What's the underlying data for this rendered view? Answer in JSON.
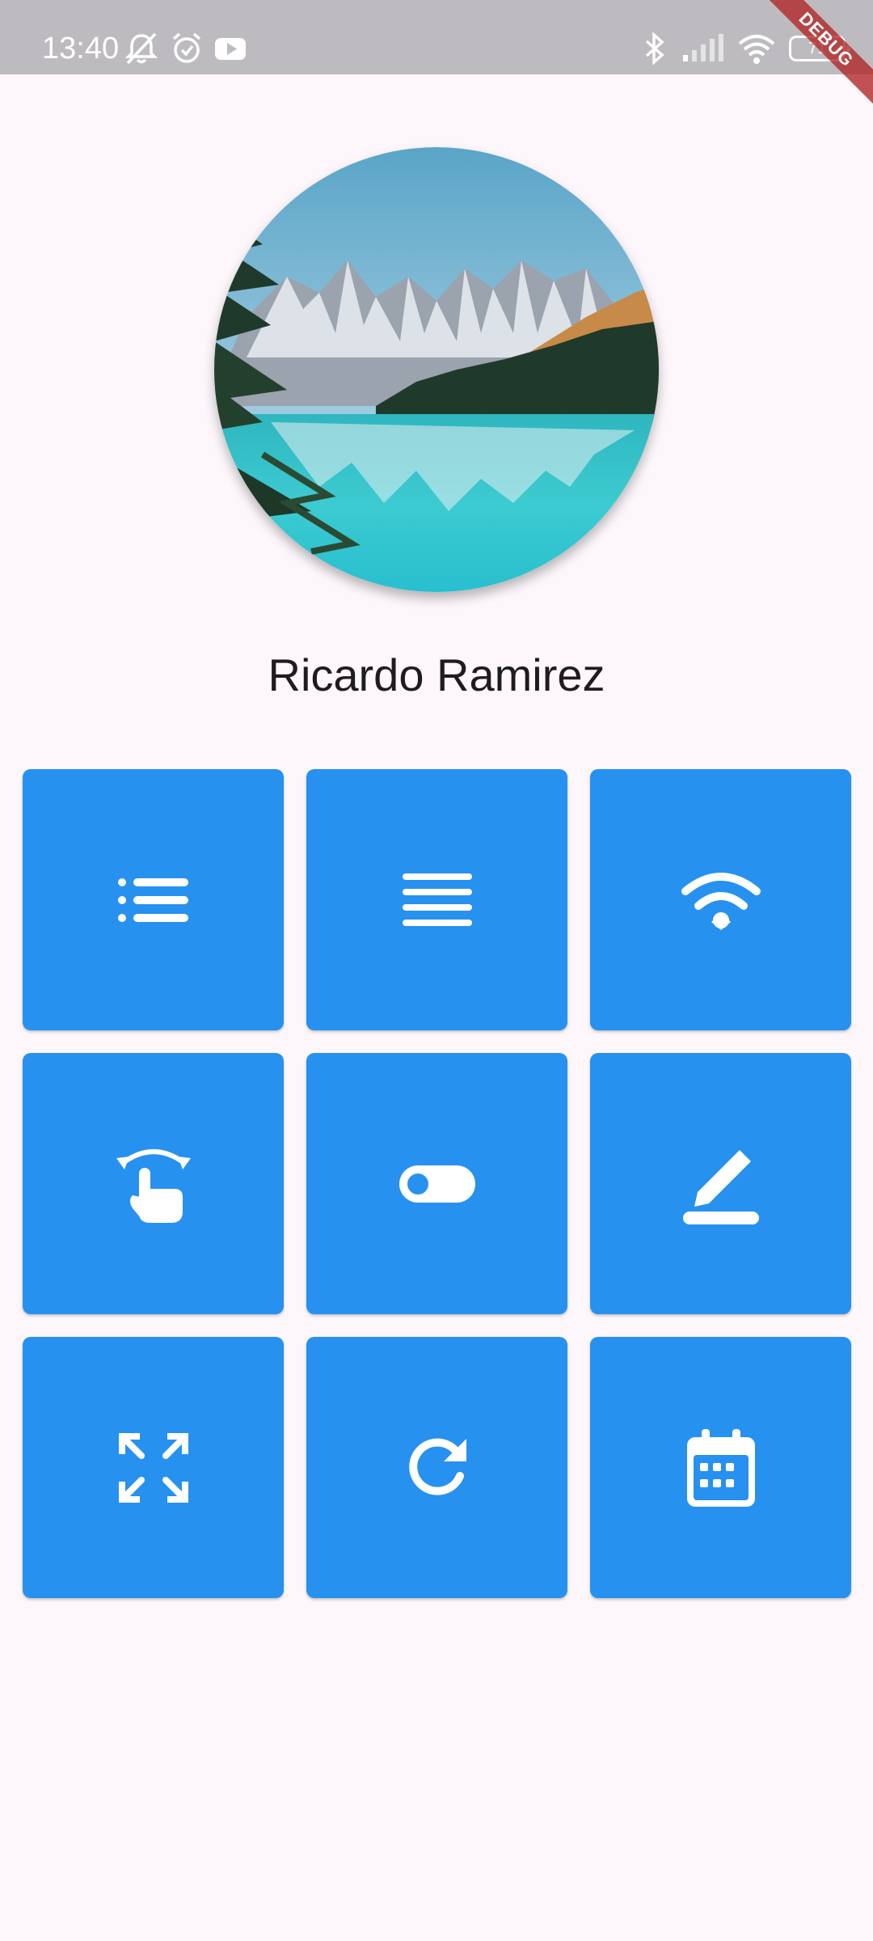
{
  "status_bar": {
    "time": "13:40",
    "battery_level": "71",
    "left_icons": [
      "notifications-muted-icon",
      "alarm-icon",
      "youtube-icon"
    ],
    "right_icons": [
      "bluetooth-icon",
      "cellular-signal-icon",
      "wifi-signal-icon",
      "battery-icon"
    ]
  },
  "debug_banner": "DEBUG",
  "profile": {
    "name": "Ricardo Ramirez",
    "avatar": "mountain-lake-photo"
  },
  "tiles": [
    {
      "icon": "list-icon"
    },
    {
      "icon": "align-justify-icon"
    },
    {
      "icon": "wifi-icon"
    },
    {
      "icon": "swipe-gesture-icon"
    },
    {
      "icon": "toggle-icon"
    },
    {
      "icon": "edit-icon"
    },
    {
      "icon": "fullscreen-icon"
    },
    {
      "icon": "refresh-icon"
    },
    {
      "icon": "calendar-icon"
    }
  ],
  "colors": {
    "tile": "#2791ef",
    "background": "#fdf7fb",
    "status_bar": "#bdbbbf"
  }
}
